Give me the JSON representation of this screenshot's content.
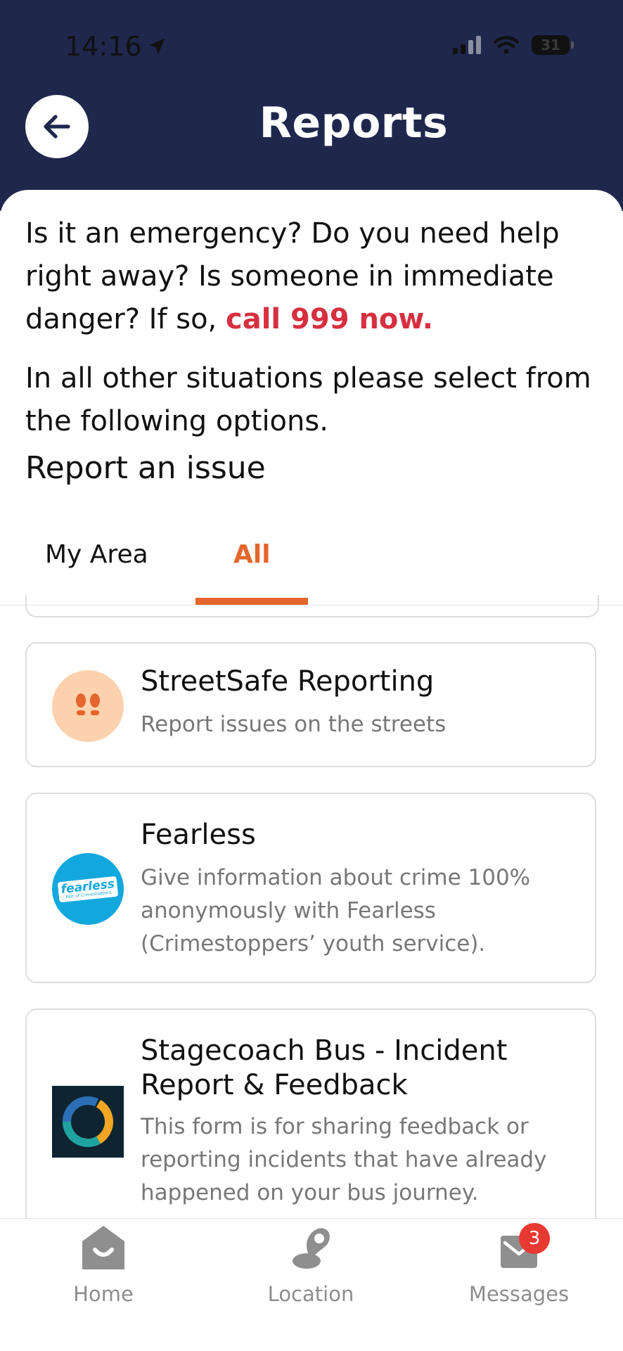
{
  "status_bar": {
    "time": "14:16",
    "battery": "31"
  },
  "header": {
    "title": "Reports"
  },
  "intro": {
    "text": "Is it an emergency? Do you need help right away? Is someone in immediate danger? If so, ",
    "emphasis": "call 999 now.",
    "text2": "In all other situations please select from the following options."
  },
  "section_title": "Report an issue",
  "tabs": [
    {
      "label": "My Area",
      "active": false
    },
    {
      "label": "All",
      "active": true
    }
  ],
  "cards": [
    {
      "title": "StreetSafe Reporting",
      "description": "Report issues on the streets",
      "icon": "footprints-icon"
    },
    {
      "title": "Fearless",
      "description": "Give information about crime 100% anonymously with Fearless (Crimestoppers’ youth service).",
      "icon": "fearless-logo",
      "logo_text": "fearless",
      "logo_subtext": "Part of Crimestoppers"
    },
    {
      "title": "Stagecoach Bus - Incident Report & Feedback",
      "description": "This form is for sharing feedback or reporting incidents that have already happened on your bus journey.",
      "icon": "stagecoach-logo"
    }
  ],
  "bottom_nav": [
    {
      "label": "Home",
      "icon": "home-icon"
    },
    {
      "label": "Location",
      "icon": "location-icon"
    },
    {
      "label": "Messages",
      "icon": "messages-icon",
      "badge": "3"
    }
  ],
  "colors": {
    "header": "#1f274d",
    "accent": "#e4662c",
    "emergency": "#d63040",
    "badge": "#e83a32"
  }
}
